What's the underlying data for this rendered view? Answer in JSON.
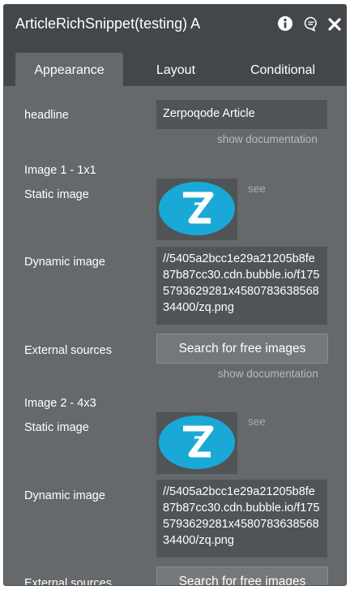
{
  "window": {
    "title": "ArticleRichSnippet(testing) A",
    "icons": [
      "info-icon",
      "comment-icon",
      "close-icon"
    ]
  },
  "tabs": [
    {
      "label": "Appearance",
      "active": true
    },
    {
      "label": "Layout",
      "active": false
    },
    {
      "label": "Conditional",
      "active": false
    }
  ],
  "headline": {
    "label": "headline",
    "value": "Zerpoqode Article",
    "doc_link": "show documentation"
  },
  "image1": {
    "section": "Image 1 - 1x1",
    "static_label": "Static image",
    "see": "see",
    "dynamic_label": "Dynamic image",
    "dynamic_value": "//5405a2bcc1e29a21205b8fe87b87cc30.cdn.bubble.io/f1755793629281x458078363856834400/zq.png",
    "external_label": "External sources",
    "search_button": "Search for free images",
    "doc_link": "show documentation"
  },
  "image2": {
    "section": "Image 2 - 4x3",
    "static_label": "Static image",
    "see": "see",
    "dynamic_label": "Dynamic image",
    "dynamic_value": "//5405a2bcc1e29a21205b8fe87b87cc30.cdn.bubble.io/f1755793629281x458078363856834400/zq.png",
    "external_label": "External sources",
    "search_button": "Search for free images"
  },
  "colors": {
    "panel": "#65696c",
    "header": "#43474a",
    "field": "#505457",
    "logo": "#1aa9d6"
  }
}
